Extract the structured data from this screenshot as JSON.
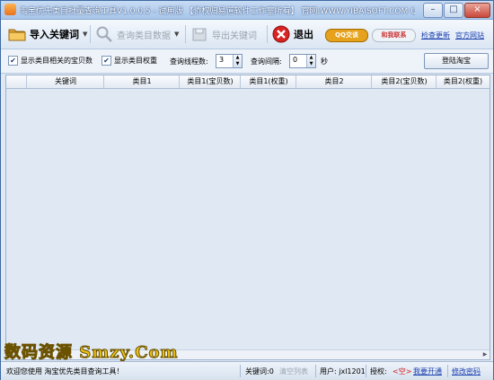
{
  "window": {
    "title": "淘宝优先类目批量查询工具V1.0.0.5 - 试用版 【侨权归易道软件工作室所有】 官网:WWW.YIBAISOFT.COM QQ:51866632",
    "controls": {
      "minimize": "–",
      "maximize": "□",
      "close": "×"
    }
  },
  "toolbar": {
    "import_label": "导入关键词",
    "query_label": "查询类目数据",
    "export_label": "导出关键词",
    "exit_label": "退出",
    "qq_badge": "QQ交谈",
    "contact_badge": "和我联系",
    "check_update": "检查更新",
    "official_site": "官方网站"
  },
  "options": {
    "show_count_label": "显示类目相关的宝贝数",
    "show_weight_label": "显示类目权重",
    "threads_label": "查询线程数:",
    "threads_value": "3",
    "interval_label": "查询间隔:",
    "interval_value": "0",
    "seconds_label": "秒",
    "login_button": "登陆淘宝"
  },
  "table": {
    "columns": [
      "关键词",
      "类目1",
      "类目1(宝贝数)",
      "类目1(权重)",
      "类目2",
      "类目2(宝贝数)",
      "类目2(权重)"
    ],
    "rows": []
  },
  "watermark": "数码资源 Smzy.Com",
  "statusbar": {
    "welcome": "欢迎您使用 淘宝优先类目查询工具！",
    "keyword_count": "关键词:0",
    "clear_list": "清空列表",
    "user": "用户: jxl1201",
    "auth_label": "授权:",
    "auth_value": "<空>",
    "open_now": "我要开通",
    "change_password": "修改密码"
  }
}
